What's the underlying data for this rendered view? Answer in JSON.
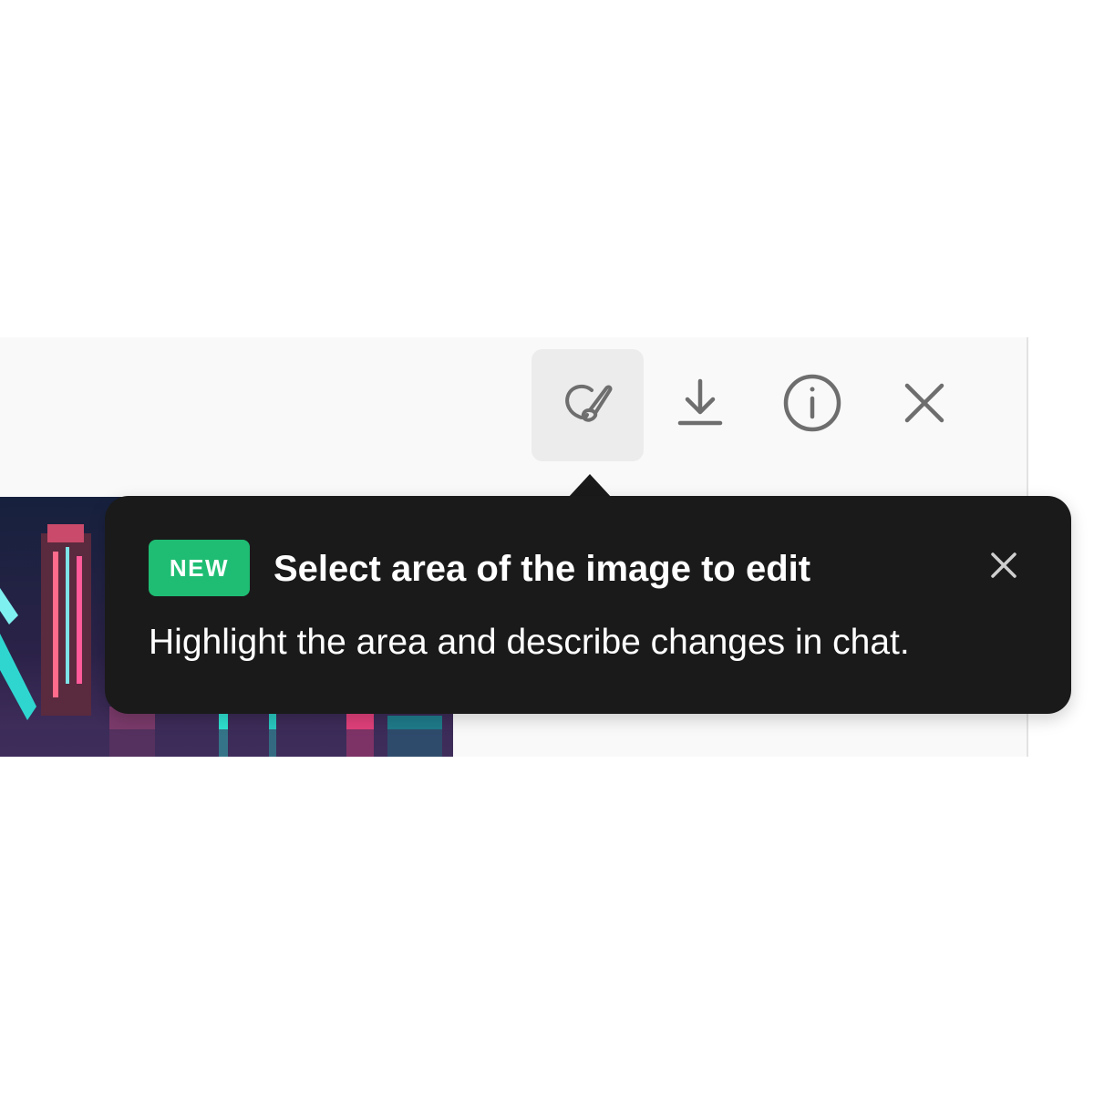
{
  "toolbar": {
    "edit_icon": "brush-edit-icon",
    "download_icon": "download-icon",
    "info_icon": "info-icon",
    "close_icon": "close-icon",
    "icon_color": "#6e6e6e",
    "active_bg": "#ececec"
  },
  "image": {
    "description_icon": "neon-city-image"
  },
  "tooltip": {
    "badge": "NEW",
    "title": "Select area of the image to edit",
    "body": "Highlight the area and describe changes in chat.",
    "close_icon": "close-icon",
    "background": "#1a1a1a",
    "badge_color": "#1fbd73"
  }
}
